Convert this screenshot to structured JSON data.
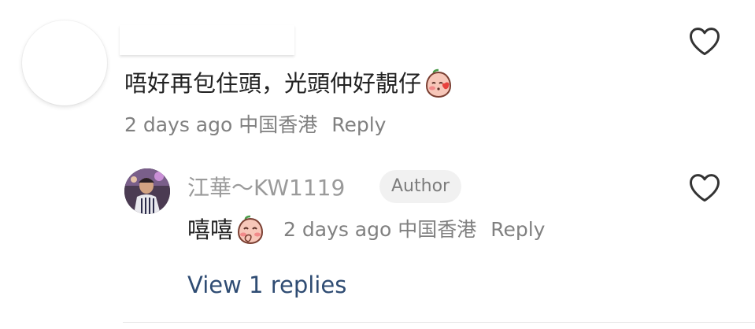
{
  "comment": {
    "text": "唔好再包住頭，光頭仲好靚仔",
    "emoji_icon": "blushing-peach-emoji",
    "time": "2 days ago",
    "location": "中国香港",
    "reply_label": "Reply",
    "like_icon": "heart-outline-icon"
  },
  "reply": {
    "username": "江華～KW1119",
    "badge": "Author",
    "text": "嘻嘻",
    "emoji_icon": "giggling-peach-emoji",
    "time": "2 days ago",
    "location": "中国香港",
    "reply_label": "Reply",
    "like_icon": "heart-outline-icon"
  },
  "view_replies_label": "View 1 replies",
  "colors": {
    "text": "#222222",
    "meta": "#808080",
    "link": "#2f4c73",
    "badge_bg": "#f1f1f1"
  }
}
